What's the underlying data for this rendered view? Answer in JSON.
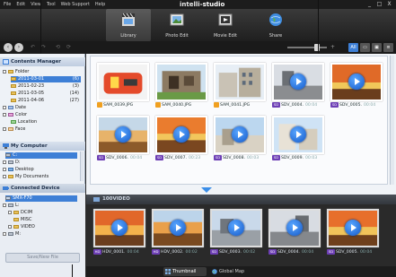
{
  "app": {
    "title_prefix": "intelli",
    "title_suffix": "-studio",
    "menu": [
      "File",
      "Edit",
      "View",
      "Tool",
      "Web Support",
      "Help"
    ],
    "window_controls": [
      "_",
      "□",
      "X"
    ]
  },
  "toolbar": {
    "tools": [
      {
        "label": "Library"
      },
      {
        "label": "Photo Edit"
      },
      {
        "label": "Movie Edit"
      },
      {
        "label": "Share"
      }
    ]
  },
  "navbar": {
    "view_all": "All"
  },
  "contents_manager": {
    "title": "Contents Manager",
    "folder_label": "Folder",
    "folders": [
      {
        "name": "2011-03-01",
        "count": "(6)"
      },
      {
        "name": "2011-02-23",
        "count": "(3)"
      },
      {
        "name": "2011-03-05",
        "count": "(14)"
      },
      {
        "name": "2011-04-06",
        "count": "(27)"
      }
    ],
    "categories": [
      "Date",
      "Color",
      "Location",
      "Face"
    ]
  },
  "my_computer": {
    "title": "My Computer",
    "items": [
      "C:",
      "D:",
      "Desktop",
      "My Documents"
    ]
  },
  "connected_device": {
    "title": "Connected Device",
    "device": "SMX-F70",
    "drive": "L:",
    "folders": [
      "DCIM",
      "MISC",
      "VIDEO"
    ],
    "drive2": "M:",
    "save_button": "Save/New File"
  },
  "library": {
    "items": [
      {
        "name": "SAM_0039.JPG",
        "type": "JPG",
        "duration": ""
      },
      {
        "name": "SAM_0040.JPG",
        "type": "JPG",
        "duration": ""
      },
      {
        "name": "SAM_0041.JPG",
        "type": "JPG",
        "duration": ""
      },
      {
        "name": "SDV_0004.",
        "type": "SD",
        "duration": "00:04"
      },
      {
        "name": "SDV_0005.",
        "type": "SD",
        "duration": "00:04"
      },
      {
        "name": "SDV_0006.",
        "type": "SD",
        "duration": "00:04"
      },
      {
        "name": "SDV_0007.",
        "type": "SD",
        "duration": "00:23"
      },
      {
        "name": "SDV_0008.",
        "type": "SD",
        "duration": "00:03"
      },
      {
        "name": "SDV_0009.",
        "type": "SD",
        "duration": "00:03"
      }
    ]
  },
  "device_view": {
    "folder": "100VIDEO",
    "items": [
      {
        "name": "HDV_0001.",
        "type": "HD",
        "duration": "00:04"
      },
      {
        "name": "HDV_0002.",
        "type": "HD",
        "duration": "00:02"
      },
      {
        "name": "SDV_0003.",
        "type": "SD",
        "duration": "00:02"
      },
      {
        "name": "SDV_0004.",
        "type": "SD",
        "duration": "00:04"
      },
      {
        "name": "SDV_0005.",
        "type": "SD",
        "duration": "00:04"
      }
    ]
  },
  "statusbar": {
    "tabs": [
      "Thumbnail",
      "Global Map"
    ]
  }
}
